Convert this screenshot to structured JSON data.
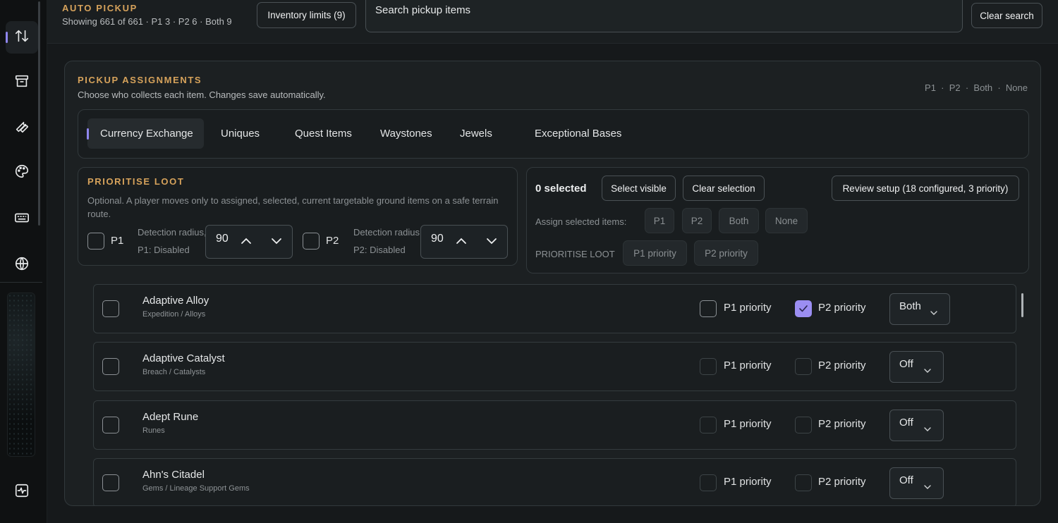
{
  "app": {
    "title": "AUTO PICKUP",
    "subtitle": "Showing 661 of 661 · P1 3 · P2 6 · Both 9"
  },
  "header": {
    "inventory_button": "Inventory limits (9)",
    "search_placeholder": "Search pickup items",
    "clear_search": "Clear search"
  },
  "rail": {
    "items": [
      {
        "icon": "arrows-up-down-icon",
        "active": true
      },
      {
        "icon": "archive-icon",
        "active": false
      },
      {
        "icon": "wrench-icon",
        "active": false
      },
      {
        "icon": "palette-icon",
        "active": false
      },
      {
        "icon": "keyboard-icon",
        "active": false
      },
      {
        "icon": "globe-icon",
        "active": false
      },
      {
        "icon": "activity-icon",
        "active": false
      }
    ]
  },
  "panel": {
    "title": "PICKUP ASSIGNMENTS",
    "subtitle": "Choose who collects each item. Changes save automatically.",
    "legend": "P1  ·  P2  ·  Both  ·  None",
    "tabs": [
      {
        "label": "Currency Exchange",
        "active": true
      },
      {
        "label": "Uniques",
        "active": false
      },
      {
        "label": "Quest Items",
        "active": false
      },
      {
        "label": "Waystones",
        "active": false
      },
      {
        "label": "Jewels",
        "active": false
      },
      {
        "label": "Exceptional Bases",
        "active": false
      }
    ]
  },
  "prioritise": {
    "title": "PRIORITISE LOOT",
    "description": "Optional. A player moves only to assigned, selected, current targetable ground items on a safe terrain route.",
    "p1": {
      "label": "P1",
      "radius_label": "Detection radius, units",
      "status": "P1: Disabled",
      "value": "90"
    },
    "p2": {
      "label": "P2",
      "radius_label": "Detection radius, units",
      "status": "P2: Disabled",
      "value": "90"
    }
  },
  "selection": {
    "count": "0 selected",
    "select_visible": "Select visible",
    "clear_selection": "Clear selection",
    "review_setup": "Review setup (18 configured, 3 priority)",
    "assign_label": "Assign selected items:",
    "assign_buttons": [
      "P1",
      "P2",
      "Both",
      "None"
    ],
    "prioritise_label": "PRIORITISE LOOT",
    "priority_buttons": [
      "P1 priority",
      "P2 priority"
    ]
  },
  "items": [
    {
      "name": "Adaptive Alloy",
      "category": "Expedition / Alloys",
      "p1_label": "P1 priority",
      "p2_label": "P2 priority",
      "p1_priority": false,
      "p2_priority": true,
      "assignment": "Both"
    },
    {
      "name": "Adaptive Catalyst",
      "category": "Breach / Catalysts",
      "p1_label": "P1 priority",
      "p2_label": "P2 priority",
      "p1_priority": false,
      "p2_priority": false,
      "assignment": "Off"
    },
    {
      "name": "Adept Rune",
      "category": "Runes",
      "p1_label": "P1 priority",
      "p2_label": "P2 priority",
      "p1_priority": false,
      "p2_priority": false,
      "assignment": "Off"
    },
    {
      "name": "Ahn's Citadel",
      "category": "Gems / Lineage Support Gems",
      "p1_label": "P1 priority",
      "p2_label": "P2 priority",
      "p1_priority": false,
      "p2_priority": false,
      "assignment": "Off"
    }
  ],
  "colors": {
    "accent": "#8f86ee",
    "gold": "#d6a25b",
    "background": "#16191b"
  }
}
